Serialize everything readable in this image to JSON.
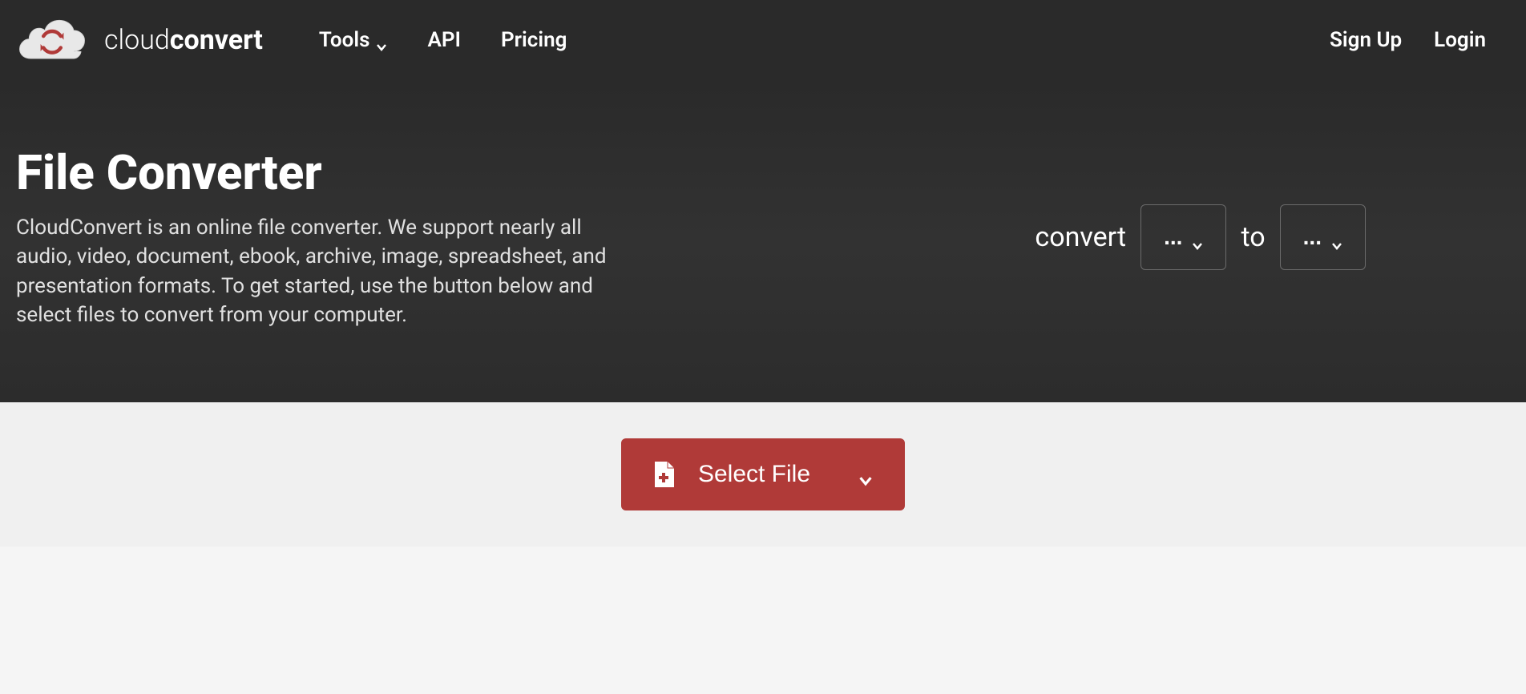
{
  "brand": {
    "prefix": "cloud",
    "suffix": "convert"
  },
  "nav": {
    "tools": "Tools",
    "api": "API",
    "pricing": "Pricing",
    "signup": "Sign Up",
    "login": "Login"
  },
  "hero": {
    "title": "File Converter",
    "description": "CloudConvert is an online file converter. We support nearly all audio, video, document, ebook, archive, image, spreadsheet, and presentation formats. To get started, use the button below and select files to convert from your computer.",
    "convert_label": "convert",
    "to_label": "to",
    "from_format": "...",
    "to_format": "..."
  },
  "actions": {
    "select_file": "Select File"
  }
}
